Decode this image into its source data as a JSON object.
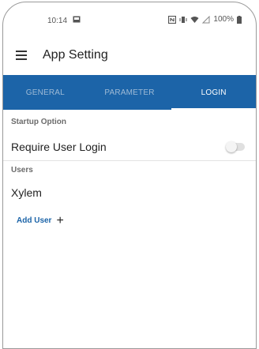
{
  "status_bar": {
    "time": "10:14",
    "battery": "100%"
  },
  "app_bar": {
    "title": "App Setting"
  },
  "tabs": [
    {
      "label": "GENERAL",
      "active": false
    },
    {
      "label": "PARAMETER",
      "active": false
    },
    {
      "label": "LOGIN",
      "active": true
    }
  ],
  "startup": {
    "header": "Startup Option",
    "require_login_label": "Require User Login",
    "require_login_enabled": false
  },
  "users": {
    "header": "Users",
    "items": [
      "Xylem"
    ],
    "add_label": "Add User"
  },
  "colors": {
    "accent": "#1c64a8"
  }
}
